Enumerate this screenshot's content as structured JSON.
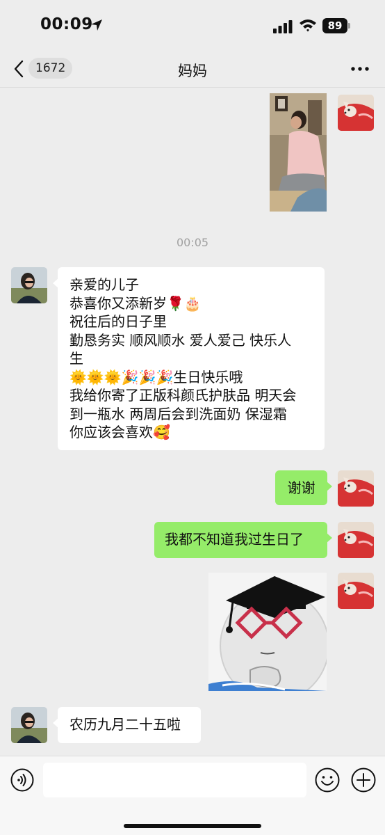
{
  "status_bar": {
    "time": "00:09",
    "battery": "89",
    "icons": [
      "location-arrow-icon",
      "cellular-signal-icon",
      "wifi-icon",
      "battery-icon"
    ]
  },
  "nav": {
    "back_icon": "chevron-left-icon",
    "unread_count": "1672",
    "title": "妈妈",
    "more_icon": "more-dots-icon"
  },
  "messages": [
    {
      "sender": "me",
      "type": "image"
    },
    {
      "type": "timestamp",
      "text": "00:05"
    },
    {
      "sender": "mom",
      "type": "text",
      "lines": [
        "亲爱的儿子",
        "恭喜你又添新岁🌹🎂",
        "祝往后的日子里",
        "勤恳务实 顺风顺水 爱人爱己 快乐人",
        "生",
        "🌞🌞🌞🎉🎉🎉生日快乐哦",
        "我给你寄了正版科颜氏护肤品 明天会",
        "到一瓶水 两周后会到洗面奶 保湿霜",
        "你应该会喜欢🥰"
      ]
    },
    {
      "sender": "me",
      "type": "text",
      "text": "谢谢"
    },
    {
      "sender": "me",
      "type": "text",
      "text": "我都不知道我过生日了"
    },
    {
      "sender": "me",
      "type": "sticker"
    },
    {
      "sender": "mom",
      "type": "text",
      "text": "农历九月二十五啦"
    }
  ],
  "input_bar": {
    "placeholder": "",
    "voice_icon": "voice-icon",
    "emoji_icon": "emoji-icon",
    "plus_icon": "plus-icon"
  },
  "colors": {
    "background": "#ededed",
    "outgoing_bubble": "#95ec69",
    "incoming_bubble": "#ffffff",
    "timestamp": "#a0a0a0"
  }
}
